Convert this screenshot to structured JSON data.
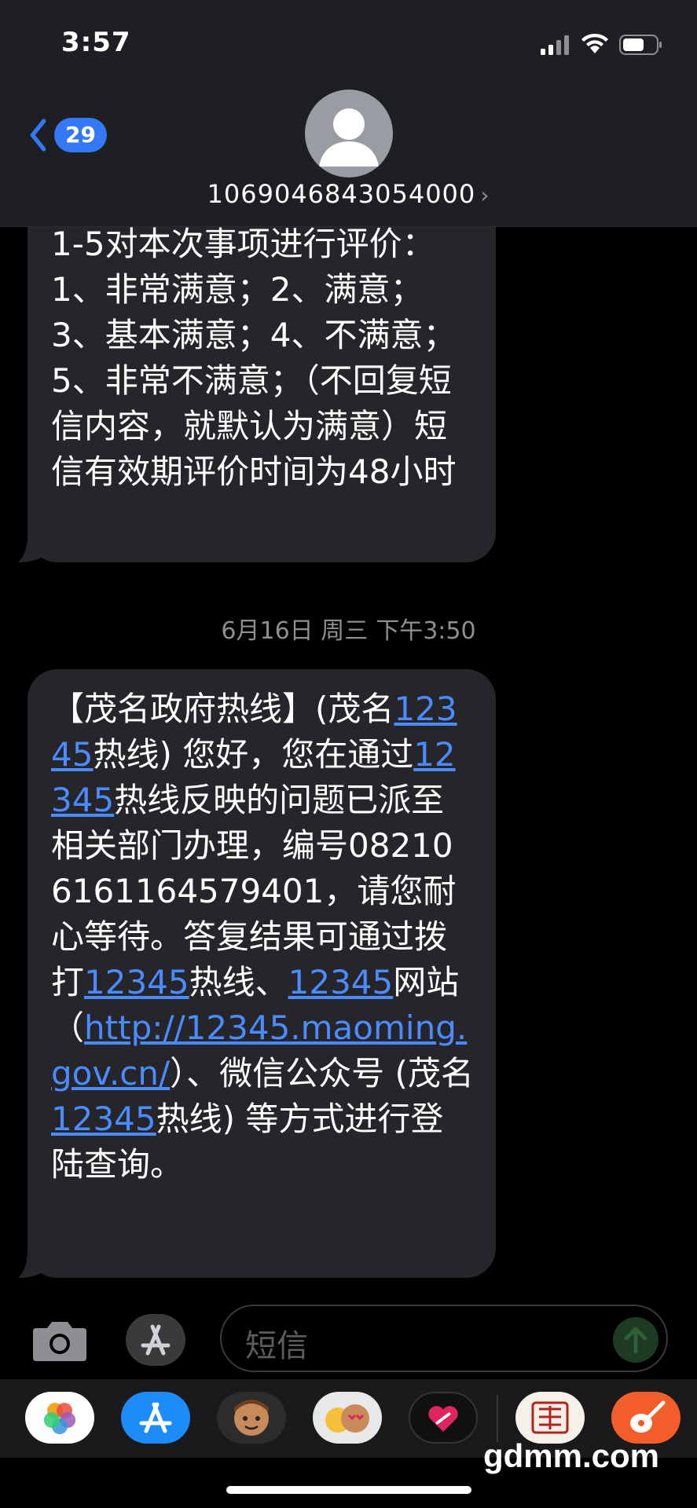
{
  "status": {
    "time": "3:57"
  },
  "header": {
    "back_count": "29",
    "contact": "1069046843054000"
  },
  "messages": [
    {
      "text": "1-5对本次事项进行评价：1、非常满意；2、满意；3、基本满意；4、不满意；5、非常不满意；（不回复短信内容，就默认为满意）短信有效期评价时间为48小时"
    }
  ],
  "timestamp": {
    "day": "6月16日 周三",
    "time": "下午3:50"
  },
  "message2": {
    "p1": "【茂名政府热线】(茂名",
    "link1": "12345",
    "p2": "热线) 您好，您在通过",
    "link2": "12345",
    "p3": "热线反映的问题已派至相关部门办理，编号082106161164579401，请您耐心等待。答复结果可通过拨打",
    "link3": "12345",
    "p4": "热线、",
    "link4": "12345",
    "p5": "网站（",
    "link5": "http://12345.maoming.gov.cn/",
    "p6": "）、微信公众号 (茂名",
    "link6": "12345",
    "p7": "热线) 等方式进行登陆查询。"
  },
  "compose": {
    "placeholder": "短信"
  },
  "watermark": "gdmm.com",
  "colors": {
    "accent": "#3478f6",
    "link": "#4a8cff",
    "bubble": "#26252a"
  }
}
